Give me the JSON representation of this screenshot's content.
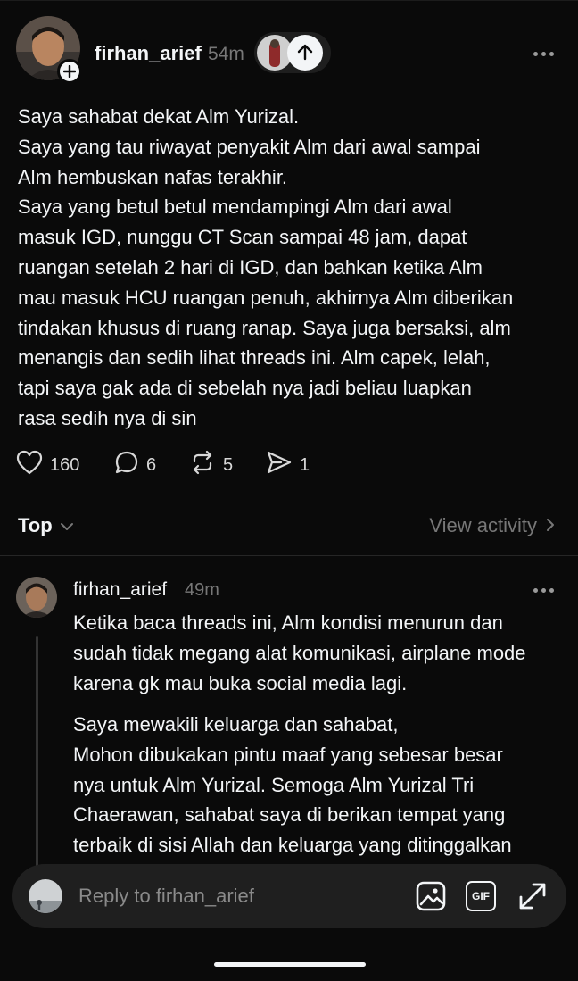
{
  "post": {
    "username": "firhan_arief",
    "timestamp": "54m",
    "lines": [
      "Saya sahabat dekat Alm Yurizal.",
      "Saya yang tau riwayat penyakit Alm dari awal sampai",
      "Alm hembuskan nafas terakhir.",
      "Saya yang betul betul mendampingi Alm dari awal",
      "masuk IGD, nunggu CT Scan sampai 48 jam, dapat",
      "ruangan setelah 2 hari di IGD, dan bahkan ketika Alm",
      "mau masuk HCU ruangan penuh, akhirnya Alm diberikan",
      "tindakan khusus di ruang ranap. Saya juga bersaksi, alm",
      "menangis dan sedih lihat threads ini. Alm capek, lelah,",
      "tapi saya gak ada di sebelah nya jadi beliau luapkan",
      "rasa sedih nya di sin"
    ],
    "stats": {
      "likes": "160",
      "replies": "6",
      "reposts": "5",
      "shares": "1"
    }
  },
  "sort": {
    "label": "Top"
  },
  "activity": {
    "label": "View activity"
  },
  "reply": {
    "username": "firhan_arief",
    "timestamp": "49m",
    "paragraph1": [
      "Ketika baca threads ini, Alm kondisi menurun dan",
      "sudah tidak megang alat komunikasi, airplane mode",
      "karena gk mau buka social media lagi."
    ],
    "paragraph2": [
      "Saya mewakili keluarga dan sahabat,",
      "Mohon dibukakan pintu maaf yang sebesar besar",
      "nya untuk Alm Yurizal. Semoga Alm Yurizal Tri",
      "Chaerawan, sahabat saya di berikan tempat yang",
      "terbaik di sisi Allah dan keluarga yang ditinggalkan"
    ]
  },
  "composer": {
    "placeholder": "Reply to firhan_arief",
    "gif_label": "GIF"
  },
  "icons": {
    "more": "more-horizontal-icon",
    "like": "heart-icon",
    "reply": "comment-icon",
    "repost": "repost-icon",
    "share": "send-icon",
    "image": "image-icon",
    "expand": "expand-icon"
  }
}
